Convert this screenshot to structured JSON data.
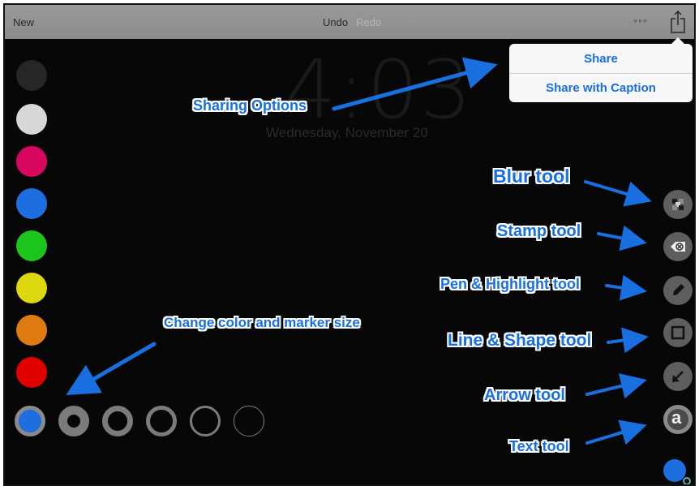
{
  "toolbar": {
    "new_label": "New",
    "undo_label": "Undo",
    "redo_label": "Redo",
    "more_label": "◦◦◦",
    "share_icon": "share-icon"
  },
  "background": {
    "time": "4:03",
    "date": "Wednesday, November 20"
  },
  "share_menu": {
    "items": [
      {
        "label": "Share"
      },
      {
        "label": "Share with Caption"
      }
    ]
  },
  "colors": {
    "palette": [
      "#262626",
      "#d7d7d7",
      "#d8085e",
      "#1d6fe0",
      "#1cc51c",
      "#ddd70d",
      "#de7a12",
      "#e10000"
    ],
    "selected": "#1d6fe0"
  },
  "marker_sizes": {
    "count": 6,
    "selected_index": 0
  },
  "tools": [
    {
      "name": "blur-tool",
      "icon": "blur-icon"
    },
    {
      "name": "stamp-tool",
      "icon": "stamp-icon"
    },
    {
      "name": "pen-tool",
      "icon": "pen-icon"
    },
    {
      "name": "shape-tool",
      "icon": "square-icon"
    },
    {
      "name": "arrow-tool",
      "icon": "arrow-icon"
    },
    {
      "name": "text-tool",
      "icon": "text-icon",
      "glyph": "a"
    }
  ],
  "callouts": {
    "sharing": "Sharing Options",
    "blur": "Blur tool",
    "stamp": "Stamp tool",
    "pen": "Pen & Highlight tool",
    "shape": "Line & Shape tool",
    "arrow": "Arrow tool",
    "text": "Text tool",
    "color": "Change color and marker size"
  }
}
